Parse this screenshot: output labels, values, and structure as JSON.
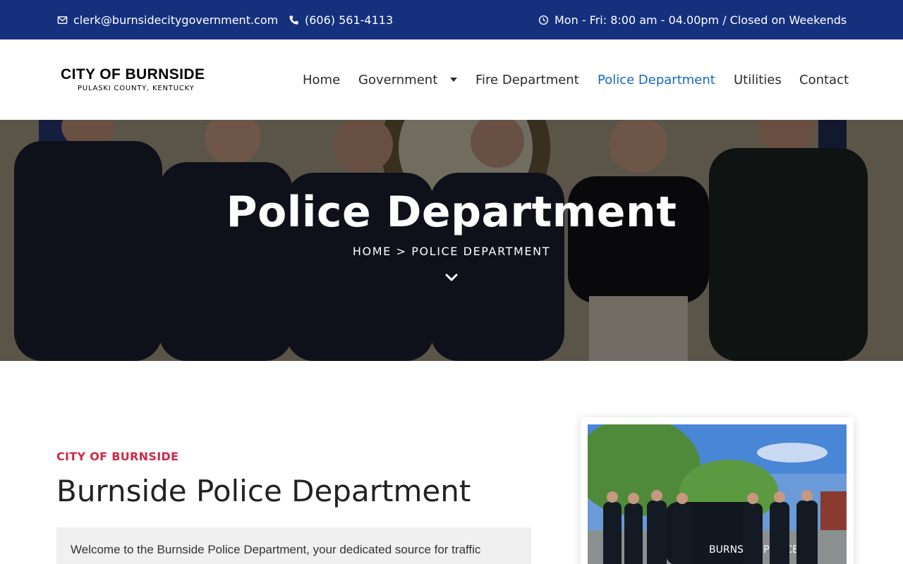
{
  "topbar": {
    "email": "clerk@burnsidecitygovernment.com",
    "phone": "(606) 561-4113",
    "hours": "Mon - Fri: 8:00 am - 04.00pm / Closed on Weekends",
    "icons": {
      "email": "envelope-icon",
      "phone": "phone-icon",
      "hours": "clock-icon"
    }
  },
  "logo": {
    "line1": "CITY OF BURNSIDE",
    "line2": "PULASKI COUNTY, KENTUCKY"
  },
  "nav": {
    "items": [
      {
        "label": "Home"
      },
      {
        "label": "Government"
      },
      {
        "label": "Fire Department"
      },
      {
        "label": "Police Department"
      },
      {
        "label": "Utilities"
      },
      {
        "label": "Contact"
      }
    ],
    "active": "Police Department"
  },
  "hero": {
    "title": "Police Department",
    "breadcrumb": "HOME > POLICE DEPARTMENT"
  },
  "content": {
    "eyebrow": "CITY OF BURNSIDE",
    "heading": "Burnside Police Department",
    "intro": "Welcome to the Burnside Police Department, your dedicated source for traffic",
    "photo_text": "BURNSIDE POLICE"
  },
  "colors": {
    "topbar": "#15317e",
    "accent_link": "#1668c4",
    "eyebrow": "#cf2945"
  }
}
